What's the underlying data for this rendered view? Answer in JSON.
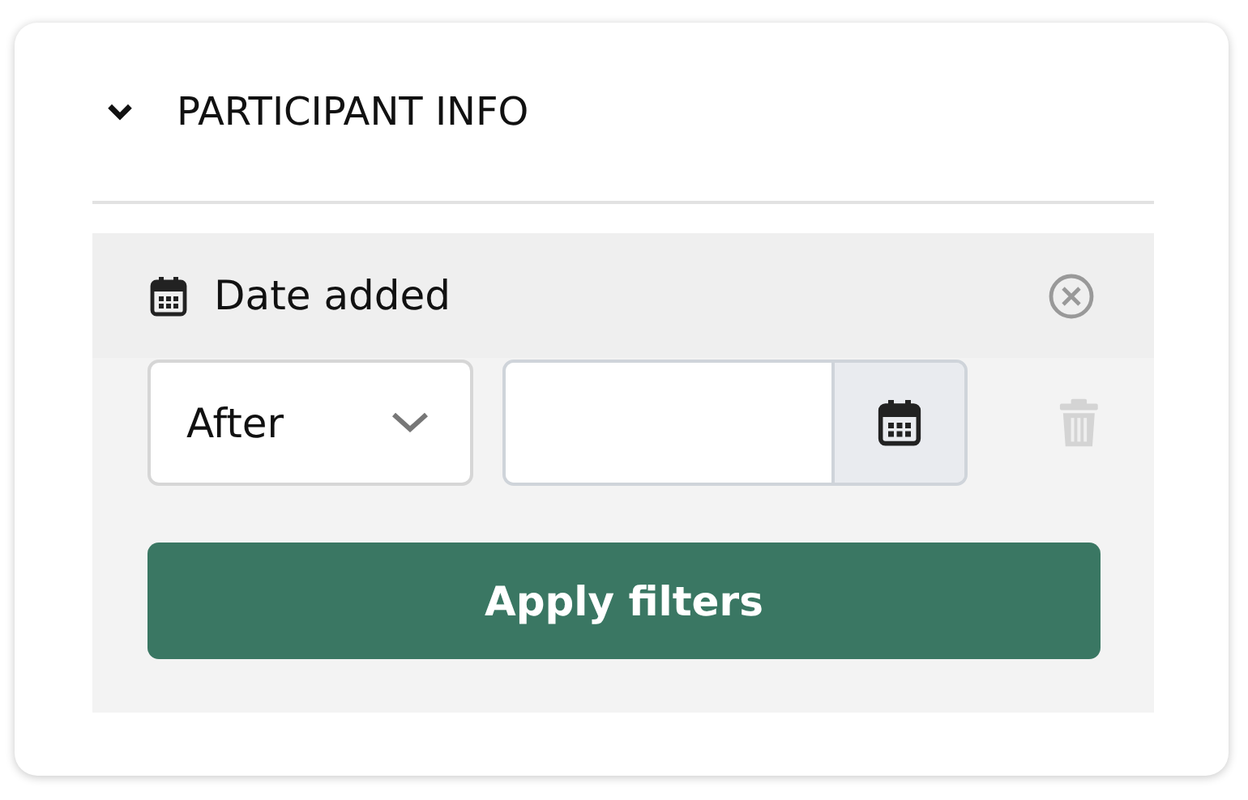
{
  "section": {
    "title": "PARTICIPANT INFO",
    "expanded": true
  },
  "filter": {
    "label": "Date added",
    "operator": "After",
    "delete_disabled": true
  },
  "apply_button": "Apply filters"
}
